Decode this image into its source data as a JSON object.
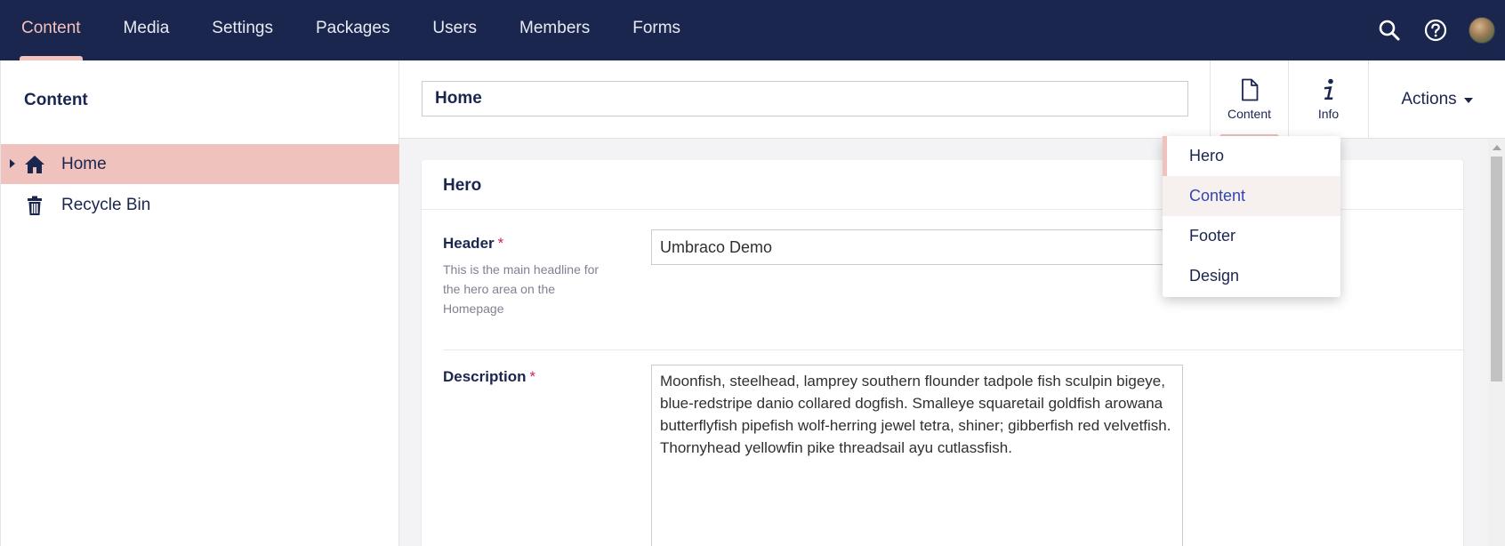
{
  "topnav": {
    "items": [
      {
        "label": "Content",
        "active": true
      },
      {
        "label": "Media"
      },
      {
        "label": "Settings"
      },
      {
        "label": "Packages"
      },
      {
        "label": "Users"
      },
      {
        "label": "Members"
      },
      {
        "label": "Forms"
      }
    ],
    "icons": [
      "search-icon",
      "help-icon",
      "user-avatar"
    ]
  },
  "sidebar": {
    "title": "Content",
    "tree": [
      {
        "label": "Home",
        "icon": "home-icon",
        "selected": true
      },
      {
        "label": "Recycle Bin",
        "icon": "trash-icon"
      }
    ]
  },
  "editor": {
    "name_value": "Home",
    "apps": [
      {
        "label": "Content",
        "icon": "document-icon",
        "active": true
      },
      {
        "label": "Info",
        "icon": "info-icon"
      }
    ],
    "actions_label": "Actions"
  },
  "group": {
    "title": "Hero",
    "properties": [
      {
        "label": "Header",
        "required": "*",
        "description": "This is the main headline for the hero area on the Homepage",
        "value": "Umbraco Demo"
      },
      {
        "label": "Description",
        "required": "*",
        "value": "Moonfish, steelhead, lamprey southern flounder tadpole fish sculpin bigeye, blue-redstripe danio collared dogfish. Smalleye squaretail goldfish arowana butterflyfish pipefish wolf-herring jewel tetra, shiner; gibberfish red velvetfish. Thornyhead yellowfin pike threadsail ayu cutlassfish."
      }
    ]
  },
  "group_dropdown": {
    "items": [
      "Hero",
      "Content",
      "Footer",
      "Design"
    ]
  },
  "colors": {
    "nav_bg": "#1b264f",
    "accent_pink": "#f0c2bd",
    "required_red": "#d42054",
    "hover_link": "#3544b1"
  }
}
